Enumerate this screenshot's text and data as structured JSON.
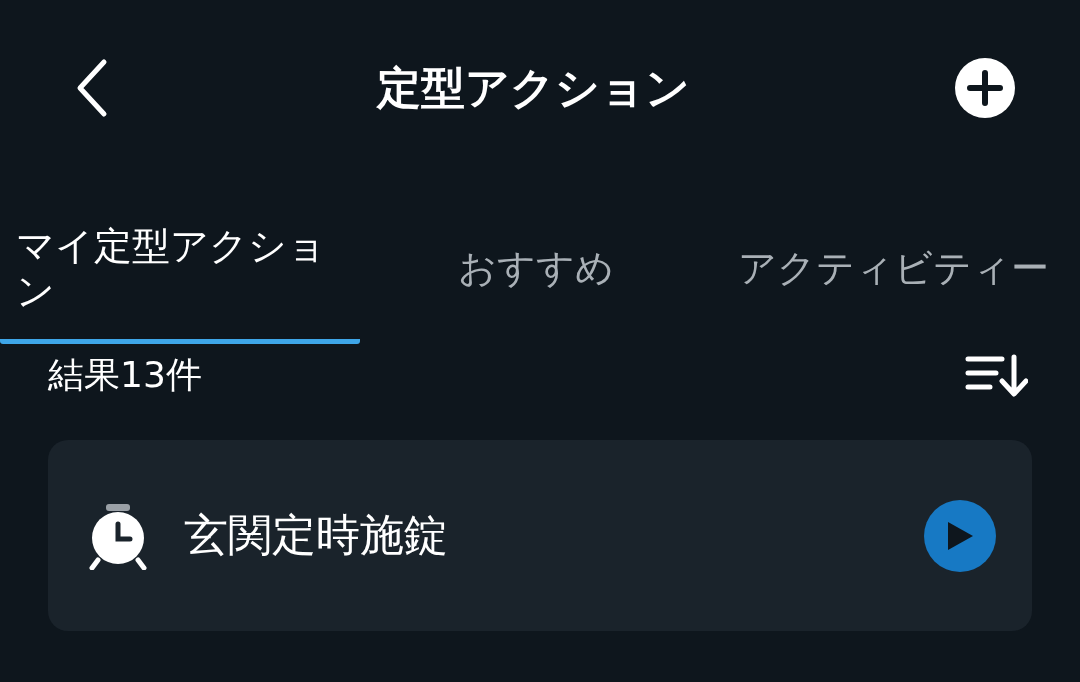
{
  "header": {
    "title": "定型アクション"
  },
  "tabs": [
    {
      "label": "マイ定型アクション",
      "selected": true
    },
    {
      "label": "おすすめ",
      "selected": false
    },
    {
      "label": "アクティビティー",
      "selected": false
    }
  ],
  "results": {
    "count": "結果13件"
  },
  "routines": [
    {
      "name": "玄関定時施錠"
    }
  ]
}
